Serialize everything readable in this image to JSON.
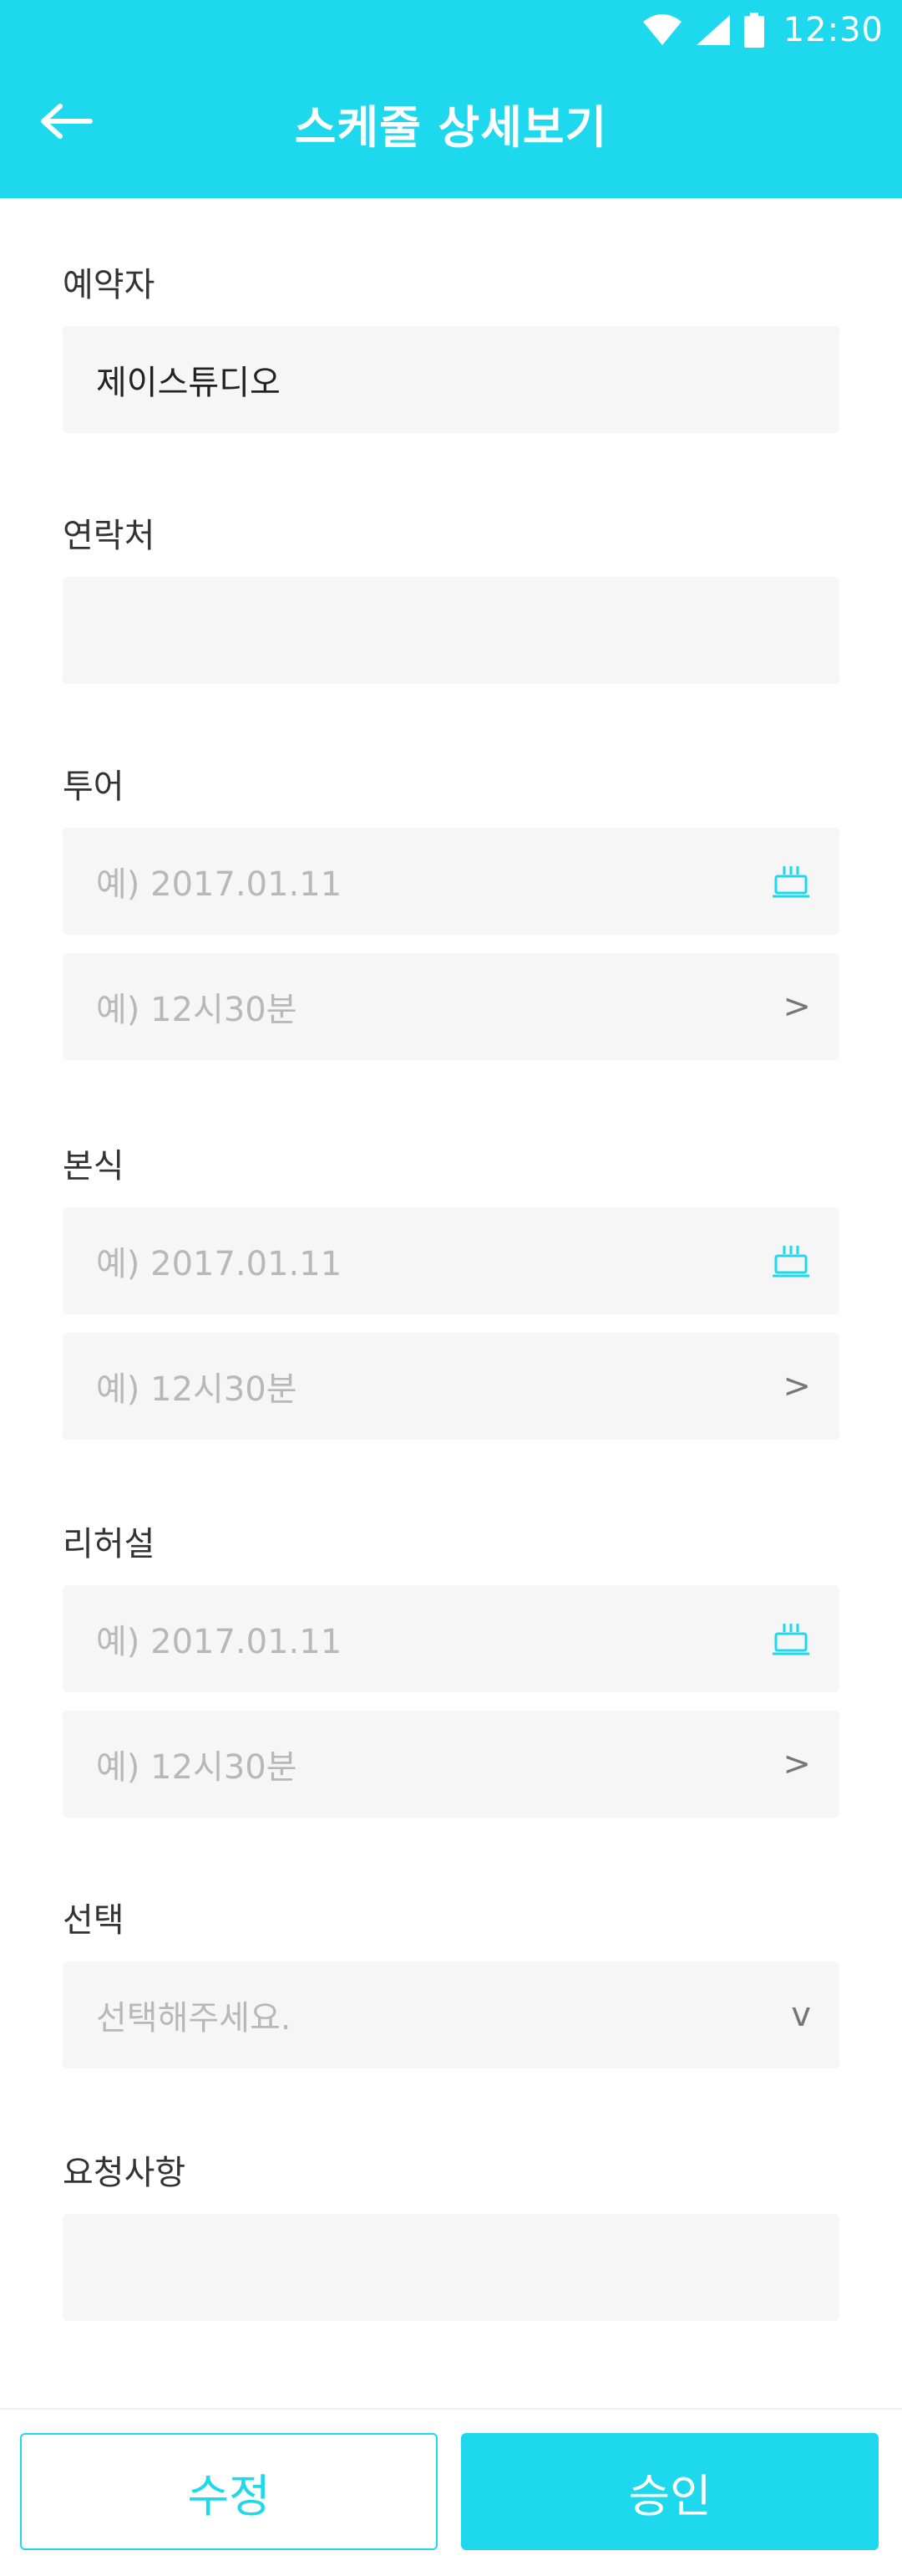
{
  "status_bar": {
    "time": "12:30"
  },
  "header": {
    "title": "스케줄 상세보기",
    "back_icon": "arrow-left-icon"
  },
  "form": {
    "booker": {
      "label": "예약자",
      "value": "제이스튜디오"
    },
    "contact": {
      "label": "연락처",
      "value": ""
    },
    "tour": {
      "label": "투어",
      "date_placeholder": "예) 2017.01.11",
      "time_placeholder": "예) 12시30분"
    },
    "ceremony": {
      "label": "본식",
      "date_placeholder": "예) 2017.01.11",
      "time_placeholder": "예) 12시30분"
    },
    "rehearsal": {
      "label": "리허설",
      "date_placeholder": "예) 2017.01.11",
      "time_placeholder": "예) 12시30분"
    },
    "selection": {
      "label": "선택",
      "placeholder": "선택해주세요."
    },
    "request": {
      "label": "요청사항",
      "value": ""
    }
  },
  "icons": {
    "chevron_right": ">",
    "chevron_down": "v"
  },
  "actions": {
    "edit_label": "수정",
    "approve_label": "승인"
  },
  "colors": {
    "accent": "#1ed8ee",
    "field_bg": "#f6f6f6",
    "placeholder": "#b8b8b8"
  }
}
